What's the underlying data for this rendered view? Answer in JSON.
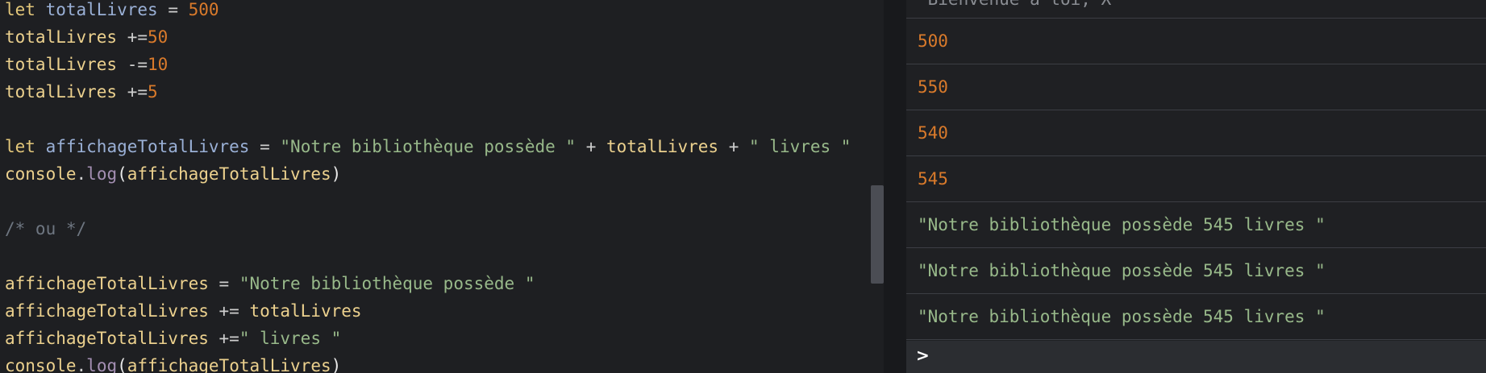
{
  "editor": {
    "lines": [
      {
        "segments": [
          {
            "t": "let",
            "c": "kw"
          },
          {
            "t": " ",
            "c": "op"
          },
          {
            "t": "totalLivres",
            "c": "var"
          },
          {
            "t": " = ",
            "c": "op"
          },
          {
            "t": "500",
            "c": "num"
          }
        ]
      },
      {
        "segments": [
          {
            "t": "totalLivres",
            "c": "ident"
          },
          {
            "t": " +=",
            "c": "op"
          },
          {
            "t": "50",
            "c": "num"
          }
        ]
      },
      {
        "segments": [
          {
            "t": "totalLivres",
            "c": "ident"
          },
          {
            "t": " -=",
            "c": "op"
          },
          {
            "t": "10",
            "c": "num"
          }
        ]
      },
      {
        "segments": [
          {
            "t": "totalLivres",
            "c": "ident"
          },
          {
            "t": " +=",
            "c": "op"
          },
          {
            "t": "5",
            "c": "num"
          }
        ]
      },
      {
        "segments": []
      },
      {
        "segments": [
          {
            "t": "let",
            "c": "kw"
          },
          {
            "t": " ",
            "c": "op"
          },
          {
            "t": "affichageTotalLivres",
            "c": "var"
          },
          {
            "t": " = ",
            "c": "op"
          },
          {
            "t": "\"Notre bibliothèque possède \"",
            "c": "str"
          },
          {
            "t": " + ",
            "c": "op"
          },
          {
            "t": "totalLivres",
            "c": "ident"
          },
          {
            "t": " + ",
            "c": "op"
          },
          {
            "t": "\" livres \"",
            "c": "str"
          }
        ]
      },
      {
        "segments": [
          {
            "t": "console",
            "c": "ident"
          },
          {
            "t": ".",
            "c": "op"
          },
          {
            "t": "log",
            "c": "fn"
          },
          {
            "t": "(",
            "c": "paren"
          },
          {
            "t": "affichageTotalLivres",
            "c": "ident"
          },
          {
            "t": ")",
            "c": "paren"
          }
        ]
      },
      {
        "segments": []
      },
      {
        "segments": [
          {
            "t": "/* ou */",
            "c": "cmt"
          }
        ]
      },
      {
        "segments": []
      },
      {
        "segments": [
          {
            "t": "affichageTotalLivres",
            "c": "ident"
          },
          {
            "t": " = ",
            "c": "op"
          },
          {
            "t": "\"Notre bibliothèque possède \"",
            "c": "str"
          }
        ]
      },
      {
        "segments": [
          {
            "t": "affichageTotalLivres",
            "c": "ident"
          },
          {
            "t": " += ",
            "c": "op"
          },
          {
            "t": "totalLivres",
            "c": "ident"
          }
        ]
      },
      {
        "segments": [
          {
            "t": "affichageTotalLivres",
            "c": "ident"
          },
          {
            "t": " +=",
            "c": "op"
          },
          {
            "t": "\" livres \"",
            "c": "str"
          }
        ]
      },
      {
        "segments": [
          {
            "t": "console",
            "c": "ident"
          },
          {
            "t": ".",
            "c": "op"
          },
          {
            "t": "log",
            "c": "fn"
          },
          {
            "t": "(",
            "c": "paren"
          },
          {
            "t": "affichageTotalLivres",
            "c": "ident"
          },
          {
            "t": ")",
            "c": "paren"
          }
        ]
      }
    ]
  },
  "console": {
    "top_partial": "\"Bienvenue à toi, X\"",
    "entries": [
      {
        "text": "500",
        "kind": "num"
      },
      {
        "text": "550",
        "kind": "num"
      },
      {
        "text": "540",
        "kind": "num"
      },
      {
        "text": "545",
        "kind": "num"
      },
      {
        "text": "\"Notre bibliothèque possède 545 livres \"",
        "kind": "str"
      },
      {
        "text": "\"Notre bibliothèque possède 545 livres \"",
        "kind": "str"
      },
      {
        "text": "\"Notre bibliothèque possède 545 livres \"",
        "kind": "str"
      }
    ],
    "prompt": ">"
  },
  "colors": {
    "keyword": "#e3c77a",
    "variable": "#9ab0d6",
    "number": "#d97a2b",
    "string": "#98b98a",
    "function": "#a48fb3",
    "comment": "#6e7681"
  }
}
